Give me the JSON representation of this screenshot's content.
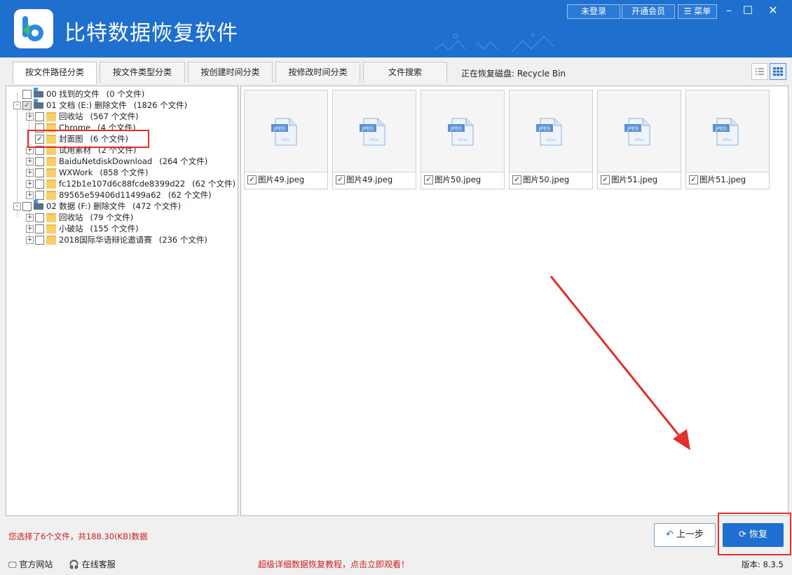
{
  "app": {
    "title": "比特数据恢复软件",
    "brand_color": "#1e6fce",
    "login_label": "未登录",
    "vip_label": "开通会员",
    "menu_label": "菜单",
    "minimize_icon": "minimize-icon",
    "maximize_icon": "maximize-icon",
    "close_icon": "close-icon"
  },
  "tabs": [
    {
      "label": "按文件路径分类",
      "active": true
    },
    {
      "label": "按文件类型分类"
    },
    {
      "label": "按创建时间分类"
    },
    {
      "label": "按修改时间分类"
    },
    {
      "label": "文件搜索"
    }
  ],
  "recovering_disk": "正在恢复磁盘: Recycle Bin",
  "tree": [
    {
      "name": "00 找到的文件",
      "count": "(0 个文件)"
    },
    {
      "name": "01 文档 (E:) 删除文件",
      "count": "(1826 个文件)"
    },
    {
      "name": "回收站",
      "count": "(567 个文件)"
    },
    {
      "name": "Chrome",
      "count": "(4 个文件)"
    },
    {
      "name": "封面图",
      "count": "(6 个文件)"
    },
    {
      "name": "试用素材",
      "count": "(2 个文件)"
    },
    {
      "name": "BaiduNetdiskDownload",
      "count": "(264 个文件)"
    },
    {
      "name": "WXWork",
      "count": "(858 个文件)"
    },
    {
      "name": "fc12b1e107d6c88fcde8399d22",
      "count": "(62 个文件)"
    },
    {
      "name": "89565e59406d11499a62",
      "count": "(62 个文件)"
    },
    {
      "name": "02 数据 (F:) 删除文件",
      "count": "(472 个文件)"
    },
    {
      "name": "回收站",
      "count": "(79 个文件)"
    },
    {
      "name": "小破站",
      "count": "(155 个文件)"
    },
    {
      "name": "2018国际华语辩论邀请赛",
      "count": "(236 个文件)"
    }
  ],
  "files": [
    {
      "name": "图片49.jpeg",
      "badge": "JPEG"
    },
    {
      "name": "图片49.jpeg",
      "badge": "JPEG"
    },
    {
      "name": "图片50.jpeg",
      "badge": "JPEG"
    },
    {
      "name": "图片50.jpeg",
      "badge": "JPEG"
    },
    {
      "name": "图片51.jpeg",
      "badge": "JPEG"
    },
    {
      "name": "图片51.jpeg",
      "badge": "JPEG"
    }
  ],
  "status": "您选择了6个文件，共188.30(KB)数据",
  "buttons": {
    "prev": "上一步",
    "recover": "恢复"
  },
  "footer": {
    "website": "官方网站",
    "support": "在线客服",
    "promo": "超级详细数据恢复教程，点击立即观看！",
    "version": "版本: 8.3.5"
  },
  "colors": {
    "highlight": "#e0312c",
    "status_text": "#c81e1e"
  }
}
